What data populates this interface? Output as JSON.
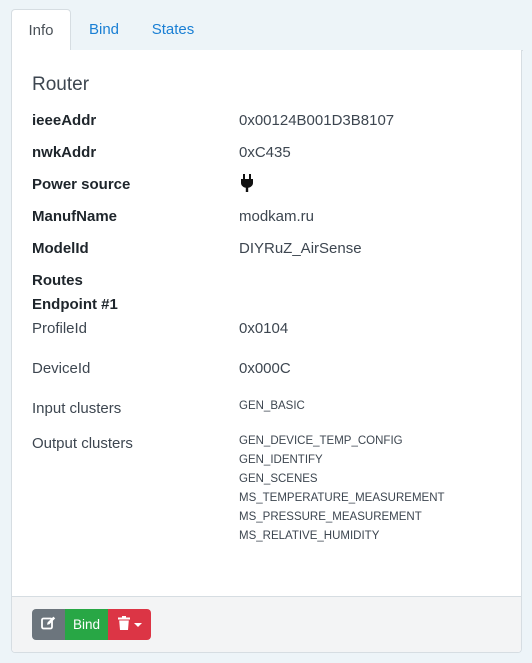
{
  "tabs": [
    {
      "label": "Info",
      "active": true
    },
    {
      "label": "Bind",
      "active": false
    },
    {
      "label": "States",
      "active": false
    }
  ],
  "device": {
    "type": "Router",
    "fields": [
      {
        "label": "ieeeAddr",
        "value": "0x00124B001D3B8107"
      },
      {
        "label": "nwkAddr",
        "value": "0xC435"
      },
      {
        "label": "Power source",
        "icon": "plug-icon"
      },
      {
        "label": "ManufName",
        "value": "modkam.ru"
      },
      {
        "label": "ModelId",
        "value": "DIYRuZ_AirSense"
      }
    ],
    "routes_label": "Routes",
    "endpoint_label": "Endpoint #1",
    "endpoint": {
      "profile_label": "ProfileId",
      "profile_value": "0x0104",
      "device_label": "DeviceId",
      "device_value": "0x000C",
      "input_label": "Input clusters",
      "input_clusters": [
        "GEN_BASIC"
      ],
      "output_label": "Output clusters",
      "output_clusters": [
        "GEN_DEVICE_TEMP_CONFIG",
        "GEN_IDENTIFY",
        "GEN_SCENES",
        "MS_TEMPERATURE_MEASUREMENT",
        "MS_PRESSURE_MEASUREMENT",
        "MS_RELATIVE_HUMIDITY"
      ]
    }
  },
  "footer": {
    "edit_icon": "edit-icon",
    "bind_label": "Bind",
    "delete_icon": "trash-icon"
  },
  "colors": {
    "link": "#1a7fd4",
    "edit": "#6c757d",
    "bind": "#28a745",
    "delete": "#dc3545"
  }
}
